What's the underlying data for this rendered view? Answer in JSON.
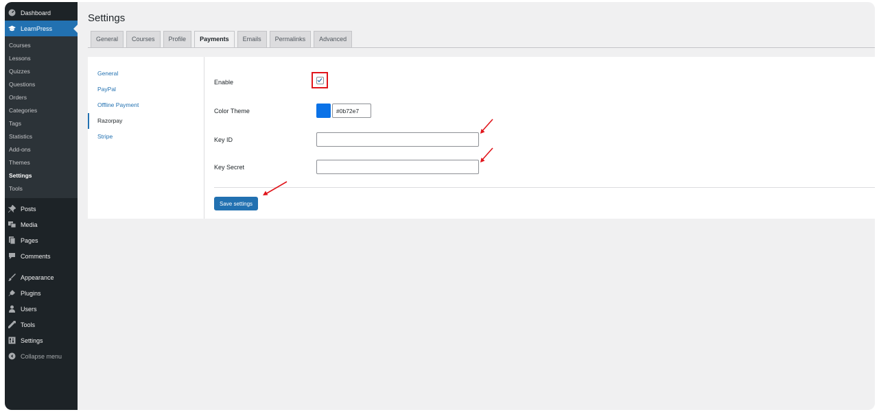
{
  "sidebar": {
    "top": [
      {
        "label": "Dashboard",
        "icon": "dashboard-icon"
      },
      {
        "label": "LearnPress",
        "icon": "graduation-cap-icon"
      }
    ],
    "submenu": [
      "Courses",
      "Lessons",
      "Quizzes",
      "Questions",
      "Orders",
      "Categories",
      "Tags",
      "Statistics",
      "Add-ons",
      "Themes",
      "Settings",
      "Tools"
    ],
    "bottom": [
      {
        "label": "Posts",
        "icon": "pin-icon"
      },
      {
        "label": "Media",
        "icon": "media-icon"
      },
      {
        "label": "Pages",
        "icon": "pages-icon"
      },
      {
        "label": "Comments",
        "icon": "comment-icon"
      },
      {
        "label": "Appearance",
        "icon": "paintbrush-icon"
      },
      {
        "label": "Plugins",
        "icon": "plug-icon"
      },
      {
        "label": "Users",
        "icon": "user-icon"
      },
      {
        "label": "Tools",
        "icon": "wrench-icon"
      },
      {
        "label": "Settings",
        "icon": "settings-icon"
      },
      {
        "label": "Collapse menu",
        "icon": "collapse-icon"
      }
    ]
  },
  "page": {
    "title": "Settings",
    "tabs": [
      "General",
      "Courses",
      "Profile",
      "Payments",
      "Emails",
      "Permalinks",
      "Advanced"
    ],
    "active_tab": "Payments"
  },
  "payment_methods": [
    "General",
    "PayPal",
    "Offline Payment",
    "Razorpay",
    "Stripe"
  ],
  "form": {
    "enable_label": "Enable",
    "enable_checked": true,
    "color_label": "Color Theme",
    "color_value": "#0b72e7",
    "key_id_label": "Key ID",
    "key_id_value": "",
    "key_secret_label": "Key Secret",
    "key_secret_value": "",
    "save_label": "Save settings"
  },
  "colors": {
    "accent": "#2271b1",
    "sidebar_bg": "#1d2327",
    "highlight": "#e0151b",
    "theme": "#0b72e7"
  }
}
